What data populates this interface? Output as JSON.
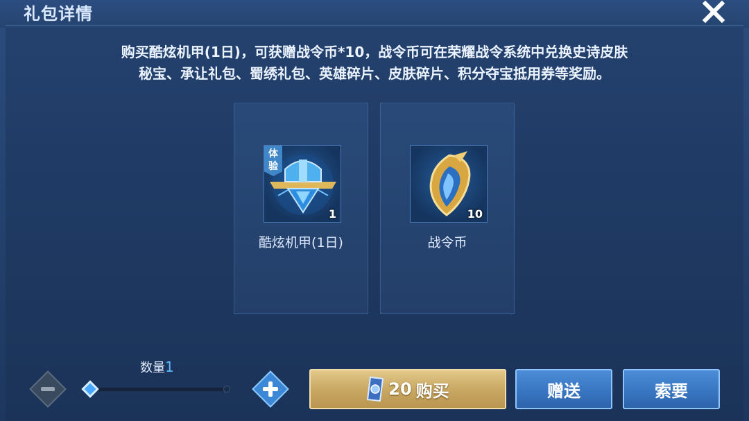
{
  "dialog": {
    "title": "礼包详情",
    "description_line1": "购买酷炫机甲(1日)，可获赠战令币*10，战令币可在荣耀战令系统中兑换史诗皮肤",
    "description_line2": "秘宝、承让礼包、蜀绣礼包、英雄碎片、皮肤碎片、积分夺宝抵用券等奖励。"
  },
  "items": [
    {
      "name": "酷炫机甲(1日)",
      "quantity": "1",
      "tag": "体验",
      "icon": "mecha-emblem-icon"
    },
    {
      "name": "战令币",
      "quantity": "10",
      "icon": "battle-pass-coin-icon"
    }
  ],
  "quantity": {
    "label": "数量",
    "value": "1"
  },
  "buttons": {
    "buy_price": "20",
    "buy_text": "购买",
    "gift": "赠送",
    "ask": "索要"
  },
  "colors": {
    "accent_blue": "#3c88d6",
    "buy_gold": "#c9a964"
  }
}
